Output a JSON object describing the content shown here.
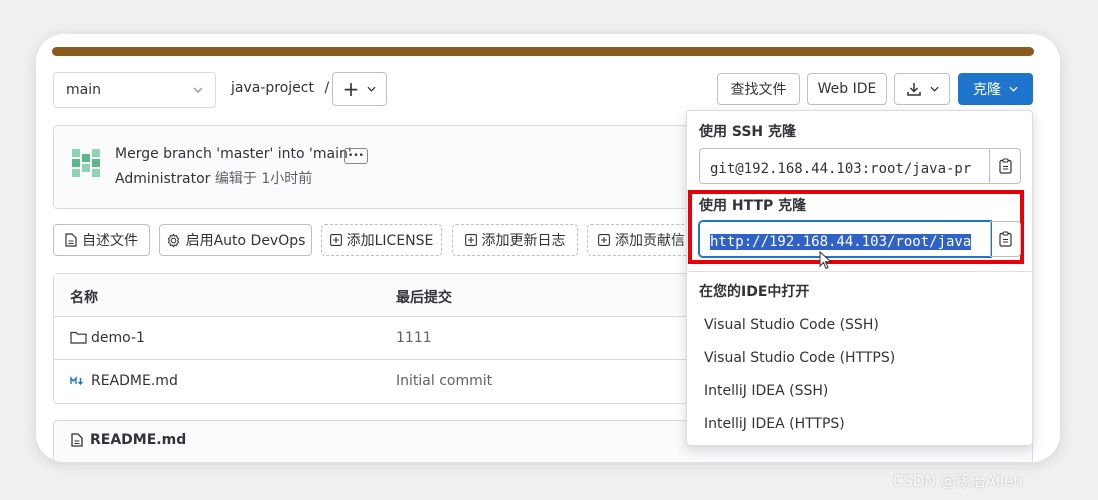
{
  "toolbar": {
    "branch": "main",
    "project_path": "java-project",
    "path_sep": "/",
    "plus_label": "+",
    "find_file": "查找文件",
    "web_ide": "Web IDE",
    "clone": "克隆"
  },
  "commit": {
    "message": "Merge branch 'master' into 'main'",
    "author": "Administrator",
    "edited": "编辑于 1小时前",
    "more": "•••"
  },
  "actions": [
    "自述文件",
    "启用Auto DevOps",
    "添加LICENSE",
    "添加更新日志",
    "添加贡献信"
  ],
  "table": {
    "headers": [
      "名称",
      "最后提交"
    ],
    "rows": [
      {
        "name": "demo-1",
        "commit": "1111",
        "icon": "folder-icon"
      },
      {
        "name": "README.md",
        "commit": "Initial commit",
        "icon": "markdown-icon"
      }
    ]
  },
  "readme": {
    "title": "README.md"
  },
  "clone_dropdown": {
    "ssh_title": "使用 SSH 克隆",
    "ssh_url": "git@192.168.44.103:root/java-pr",
    "http_title": "使用 HTTP 克隆",
    "http_url": "http://192.168.44.103/root/java",
    "ide_title": "在您的IDE中打开",
    "ide_options": [
      "Visual Studio Code (SSH)",
      "Visual Studio Code (HTTPS)",
      "IntelliJ IDEA (SSH)",
      "IntelliJ IDEA (HTTPS)"
    ]
  },
  "watermark": "CSDN @孫治Allen",
  "colors": {
    "primary": "#1f75cb",
    "highlight": "#e8000b",
    "topbar": "#8b5a1f"
  }
}
